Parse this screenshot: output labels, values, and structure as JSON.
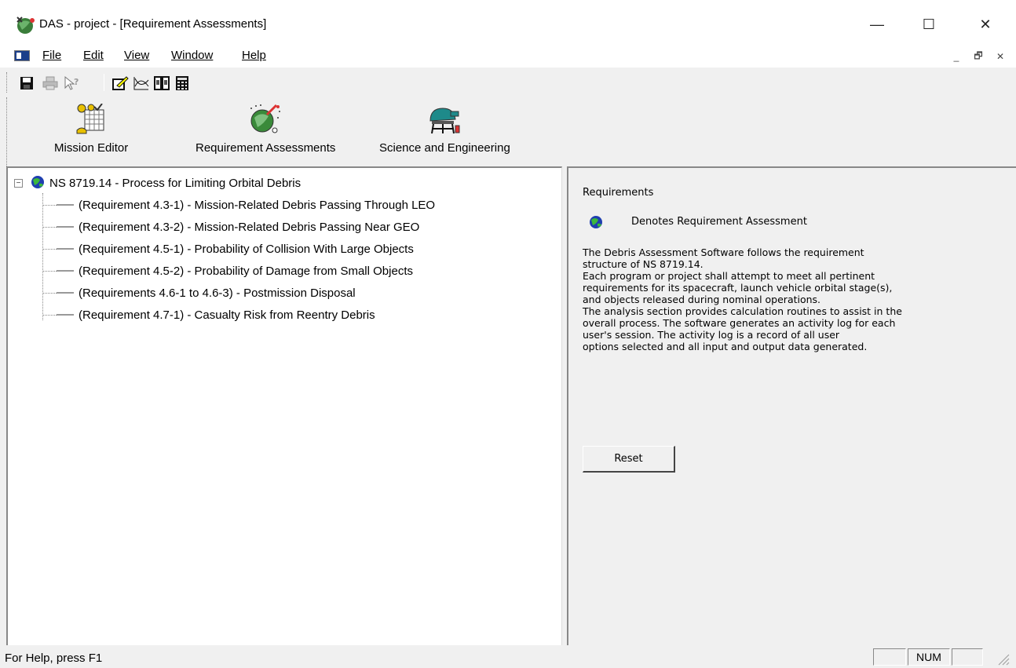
{
  "window": {
    "title": "DAS - project - [Requirement Assessments]",
    "controls": {
      "minimize": "—",
      "maximize": "☐",
      "close": "✕"
    }
  },
  "menu": {
    "items": [
      "File",
      "Edit",
      "View",
      "Window",
      "Help"
    ],
    "mdi_controls": {
      "minimize": "_",
      "restore": "🗗",
      "close": "✕"
    }
  },
  "toolbar": {
    "icons": [
      "save-icon",
      "print-icon",
      "context-help-icon",
      "edit-icon",
      "graph-icon",
      "book-icon",
      "calculator-icon"
    ]
  },
  "launcher": {
    "mission_editor": "Mission Editor",
    "requirement_assessments": "Requirement Assessments",
    "science_engineering": "Science and Engineering"
  },
  "tree": {
    "root": "NS 8719.14 - Process for Limiting Orbital Debris",
    "expander": "−",
    "children": [
      "(Requirement 4.3-1) - Mission-Related Debris Passing Through LEO",
      "(Requirement 4.3-2) - Mission-Related Debris Passing Near GEO",
      "(Requirement 4.5-1) - Probability of Collision With Large Objects",
      "(Requirement 4.5-2) - Probability of Damage from Small Objects",
      "(Requirements 4.6-1 to 4.6-3) - Postmission Disposal",
      "(Requirement 4.7-1) - Casualty Risk from Reentry Debris"
    ]
  },
  "panel": {
    "title": "Requirements",
    "legend": "Denotes Requirement Assessment",
    "description": "The Debris Assessment Software follows the requirement\nstructure of NS 8719.14.\nEach program or project shall attempt to meet all pertinent\nrequirements for its spacecraft, launch vehicle orbital stage(s),\nand objects released during nominal operations.\nThe analysis section provides calculation routines to assist in the\noverall process. The software generates an activity log for each\nuser's session. The activity log is a record of all user\noptions selected and all input and output data generated.",
    "reset_label": "Reset"
  },
  "status": {
    "help_text": "For Help, press F1",
    "num": "NUM"
  }
}
